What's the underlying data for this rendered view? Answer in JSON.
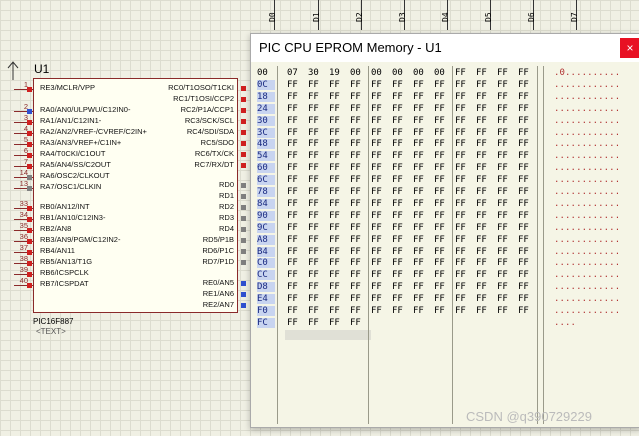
{
  "bus_labels": [
    "D0",
    "D1",
    "D2",
    "D3",
    "D4",
    "D5",
    "D6",
    "D7"
  ],
  "chip": {
    "ref": "U1",
    "part": "PIC16F887",
    "text_placeholder": "<TEXT>",
    "left_pins": [
      {
        "num": "1",
        "name": "RE3/MCLR/VPP"
      },
      {
        "num": "2",
        "name": "RA0/AN0/ULPWU/C12IN0-"
      },
      {
        "num": "3",
        "name": "RA1/AN1/C12IN1-"
      },
      {
        "num": "4",
        "name": "RA2/AN2/VREF-/CVREF/C2IN+"
      },
      {
        "num": "5",
        "name": "RA3/AN3/VREF+/C1IN+"
      },
      {
        "num": "6",
        "name": "RA4/T0CKI/C1OUT"
      },
      {
        "num": "7",
        "name": "RA5/AN4/SS/C2OUT"
      },
      {
        "num": "14",
        "name": "RA6/OSC2/CLKOUT"
      },
      {
        "num": "13",
        "name": "RA7/OSC1/CLKIN"
      },
      {
        "num": "33",
        "name": "RB0/AN12/INT"
      },
      {
        "num": "34",
        "name": "RB1/AN10/C12IN3-"
      },
      {
        "num": "35",
        "name": "RB2/AN8"
      },
      {
        "num": "36",
        "name": "RB3/AN9/PGM/C12IN2-"
      },
      {
        "num": "37",
        "name": "RB4/AN11"
      },
      {
        "num": "38",
        "name": "RB5/AN13/T1G"
      },
      {
        "num": "39",
        "name": "RB6/ICSPCLK"
      },
      {
        "num": "40",
        "name": "RB7/ICSPDAT"
      }
    ],
    "right_pins": [
      "RC0/T1OSO/T1CKI",
      "RC1/T1OSI/CCP2",
      "RC2/P1A/CCP1",
      "RC3/SCK/SCL",
      "RC4/SDI/SDA",
      "RC5/SDO",
      "RC6/TX/CK",
      "RC7/RX/DT",
      "RD0",
      "RD1",
      "RD2",
      "RD3",
      "RD4",
      "RD5/P1B",
      "RD6/P1C",
      "RD7/P1D",
      "RE0/AN5",
      "RE1/AN6",
      "RE2/AN7"
    ]
  },
  "memory_window": {
    "title": "PIC CPU EPROM Memory - U1",
    "close_glyph": "×",
    "rows": [
      {
        "addr": "00",
        "bytes": [
          "07",
          "30",
          "19",
          "00",
          "00",
          "00",
          "00",
          "00",
          "FF",
          "FF",
          "FF",
          "FF"
        ],
        "ascii": ".0.........."
      },
      {
        "addr": "0C",
        "bytes": [
          "FF",
          "FF",
          "FF",
          "FF",
          "FF",
          "FF",
          "FF",
          "FF",
          "FF",
          "FF",
          "FF",
          "FF"
        ],
        "ascii": "............"
      },
      {
        "addr": "18",
        "bytes": [
          "FF",
          "FF",
          "FF",
          "FF",
          "FF",
          "FF",
          "FF",
          "FF",
          "FF",
          "FF",
          "FF",
          "FF"
        ],
        "ascii": "............"
      },
      {
        "addr": "24",
        "bytes": [
          "FF",
          "FF",
          "FF",
          "FF",
          "FF",
          "FF",
          "FF",
          "FF",
          "FF",
          "FF",
          "FF",
          "FF"
        ],
        "ascii": "............"
      },
      {
        "addr": "30",
        "bytes": [
          "FF",
          "FF",
          "FF",
          "FF",
          "FF",
          "FF",
          "FF",
          "FF",
          "FF",
          "FF",
          "FF",
          "FF"
        ],
        "ascii": "............"
      },
      {
        "addr": "3C",
        "bytes": [
          "FF",
          "FF",
          "FF",
          "FF",
          "FF",
          "FF",
          "FF",
          "FF",
          "FF",
          "FF",
          "FF",
          "FF"
        ],
        "ascii": "............"
      },
      {
        "addr": "48",
        "bytes": [
          "FF",
          "FF",
          "FF",
          "FF",
          "FF",
          "FF",
          "FF",
          "FF",
          "FF",
          "FF",
          "FF",
          "FF"
        ],
        "ascii": "............"
      },
      {
        "addr": "54",
        "bytes": [
          "FF",
          "FF",
          "FF",
          "FF",
          "FF",
          "FF",
          "FF",
          "FF",
          "FF",
          "FF",
          "FF",
          "FF"
        ],
        "ascii": "............"
      },
      {
        "addr": "60",
        "bytes": [
          "FF",
          "FF",
          "FF",
          "FF",
          "FF",
          "FF",
          "FF",
          "FF",
          "FF",
          "FF",
          "FF",
          "FF"
        ],
        "ascii": "............"
      },
      {
        "addr": "6C",
        "bytes": [
          "FF",
          "FF",
          "FF",
          "FF",
          "FF",
          "FF",
          "FF",
          "FF",
          "FF",
          "FF",
          "FF",
          "FF"
        ],
        "ascii": "............"
      },
      {
        "addr": "78",
        "bytes": [
          "FF",
          "FF",
          "FF",
          "FF",
          "FF",
          "FF",
          "FF",
          "FF",
          "FF",
          "FF",
          "FF",
          "FF"
        ],
        "ascii": "............"
      },
      {
        "addr": "84",
        "bytes": [
          "FF",
          "FF",
          "FF",
          "FF",
          "FF",
          "FF",
          "FF",
          "FF",
          "FF",
          "FF",
          "FF",
          "FF"
        ],
        "ascii": "............"
      },
      {
        "addr": "90",
        "bytes": [
          "FF",
          "FF",
          "FF",
          "FF",
          "FF",
          "FF",
          "FF",
          "FF",
          "FF",
          "FF",
          "FF",
          "FF"
        ],
        "ascii": "............"
      },
      {
        "addr": "9C",
        "bytes": [
          "FF",
          "FF",
          "FF",
          "FF",
          "FF",
          "FF",
          "FF",
          "FF",
          "FF",
          "FF",
          "FF",
          "FF"
        ],
        "ascii": "............"
      },
      {
        "addr": "A8",
        "bytes": [
          "FF",
          "FF",
          "FF",
          "FF",
          "FF",
          "FF",
          "FF",
          "FF",
          "FF",
          "FF",
          "FF",
          "FF"
        ],
        "ascii": "............"
      },
      {
        "addr": "B4",
        "bytes": [
          "FF",
          "FF",
          "FF",
          "FF",
          "FF",
          "FF",
          "FF",
          "FF",
          "FF",
          "FF",
          "FF",
          "FF"
        ],
        "ascii": "............"
      },
      {
        "addr": "C0",
        "bytes": [
          "FF",
          "FF",
          "FF",
          "FF",
          "FF",
          "FF",
          "FF",
          "FF",
          "FF",
          "FF",
          "FF",
          "FF"
        ],
        "ascii": "............"
      },
      {
        "addr": "CC",
        "bytes": [
          "FF",
          "FF",
          "FF",
          "FF",
          "FF",
          "FF",
          "FF",
          "FF",
          "FF",
          "FF",
          "FF",
          "FF"
        ],
        "ascii": "............"
      },
      {
        "addr": "D8",
        "bytes": [
          "FF",
          "FF",
          "FF",
          "FF",
          "FF",
          "FF",
          "FF",
          "FF",
          "FF",
          "FF",
          "FF",
          "FF"
        ],
        "ascii": "............"
      },
      {
        "addr": "E4",
        "bytes": [
          "FF",
          "FF",
          "FF",
          "FF",
          "FF",
          "FF",
          "FF",
          "FF",
          "FF",
          "FF",
          "FF",
          "FF"
        ],
        "ascii": "............"
      },
      {
        "addr": "F0",
        "bytes": [
          "FF",
          "FF",
          "FF",
          "FF",
          "FF",
          "FF",
          "FF",
          "FF",
          "FF",
          "FF",
          "FF",
          "FF"
        ],
        "ascii": "............"
      },
      {
        "addr": "FC",
        "bytes": [
          "FF",
          "FF",
          "FF",
          "FF"
        ],
        "ascii": "...."
      }
    ]
  },
  "watermark": "CSDN @q390729229",
  "colors": {
    "pin_blue": "#3050d0",
    "pin_red": "#d02020",
    "pin_gray": "#808080",
    "addr_highlight": "#c8d4f0"
  }
}
